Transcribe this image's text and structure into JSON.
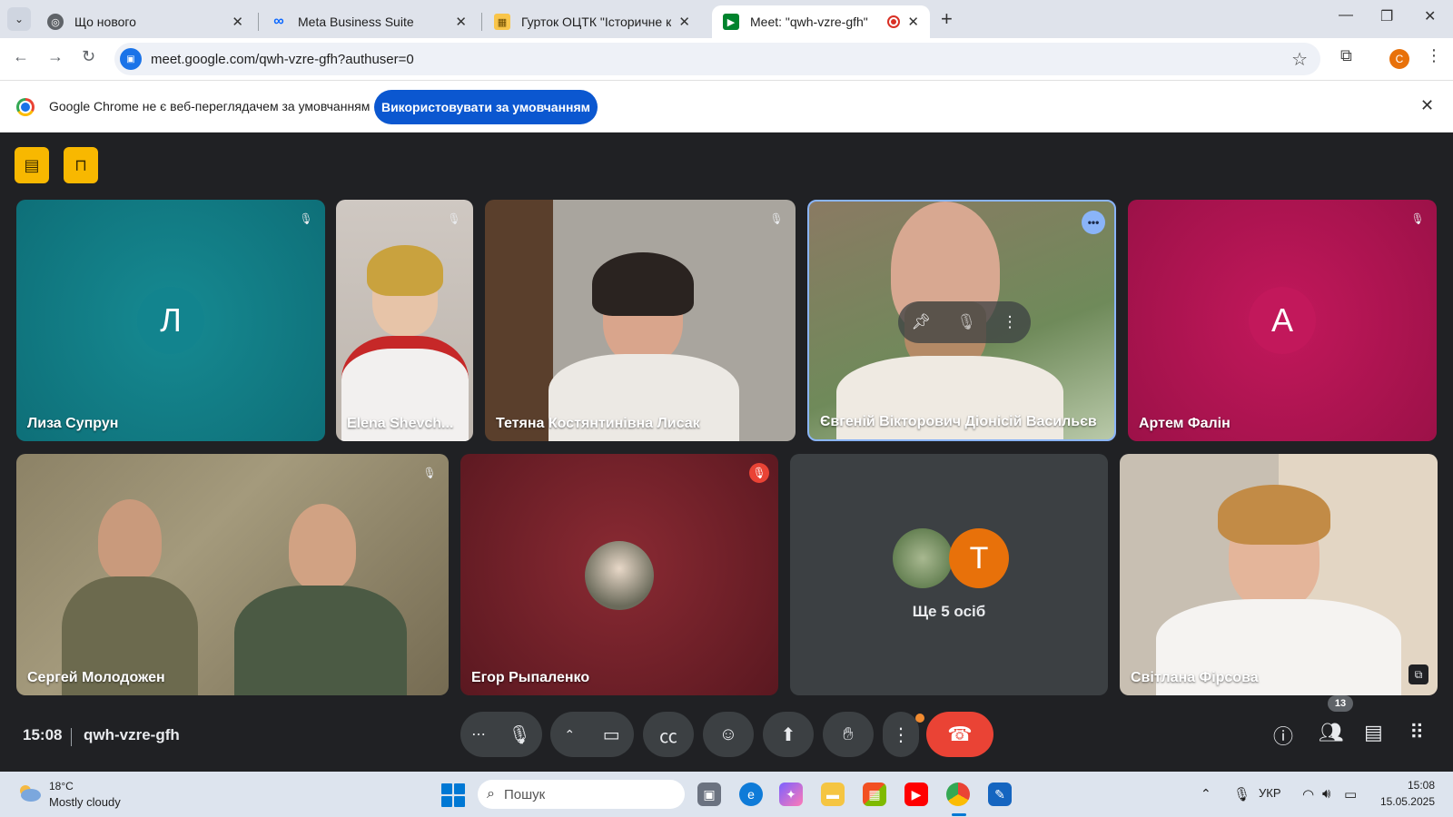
{
  "tabs": [
    {
      "title": "Що нового",
      "active": false
    },
    {
      "title": "Meta Business Suite",
      "active": false
    },
    {
      "title": "Гурток ОЦТК \"Історичне краєз",
      "active": false
    },
    {
      "title": "Meet: \"qwh-vzre-gfh\"",
      "active": true
    }
  ],
  "address": {
    "url": "meet.google.com/qwh-vzre-gfh?authuser=0"
  },
  "profile_initial": "C",
  "infobar": {
    "message": "Google Chrome не є веб-переглядачем за умовчанням",
    "button_label": "Використовувати за умовчанням"
  },
  "participants": [
    {
      "name": "Лиза Супрун",
      "initial": "Л",
      "color": "#12848e",
      "muted": true
    },
    {
      "name": "Elena Shevch...",
      "muted": true
    },
    {
      "name": "Тетяна Костянтинівна Лисак",
      "muted": true
    },
    {
      "name": "Євгеній Вікторович Діонісій Васильєв",
      "speaking": true
    },
    {
      "name": "Артем Фалін",
      "initial": "А",
      "color": "#c2185b",
      "muted": true
    },
    {
      "name": "Сергей Молодожен",
      "muted": true
    },
    {
      "name": "Егор Рыпаленко",
      "muted": true
    },
    {
      "name": "Світлана Фірсова"
    }
  ],
  "others": {
    "label": "Ще 5 осіб",
    "initial": "Т",
    "color": "#e8710a"
  },
  "meeting": {
    "time": "15:08",
    "code": "qwh-vzre-gfh",
    "participant_count": "13"
  },
  "taskbar": {
    "weather_temp": "18°C",
    "weather_desc": "Mostly cloudy",
    "search_placeholder": "Пошук",
    "language": "УКР",
    "time": "15:08",
    "date": "15.05.2025"
  },
  "colors": {
    "meet_bg": "#202124",
    "control_bg": "#3c4043",
    "end_call": "#ea4335",
    "accent_blue": "#0b57d0",
    "tool_yellow": "#f8b800"
  }
}
